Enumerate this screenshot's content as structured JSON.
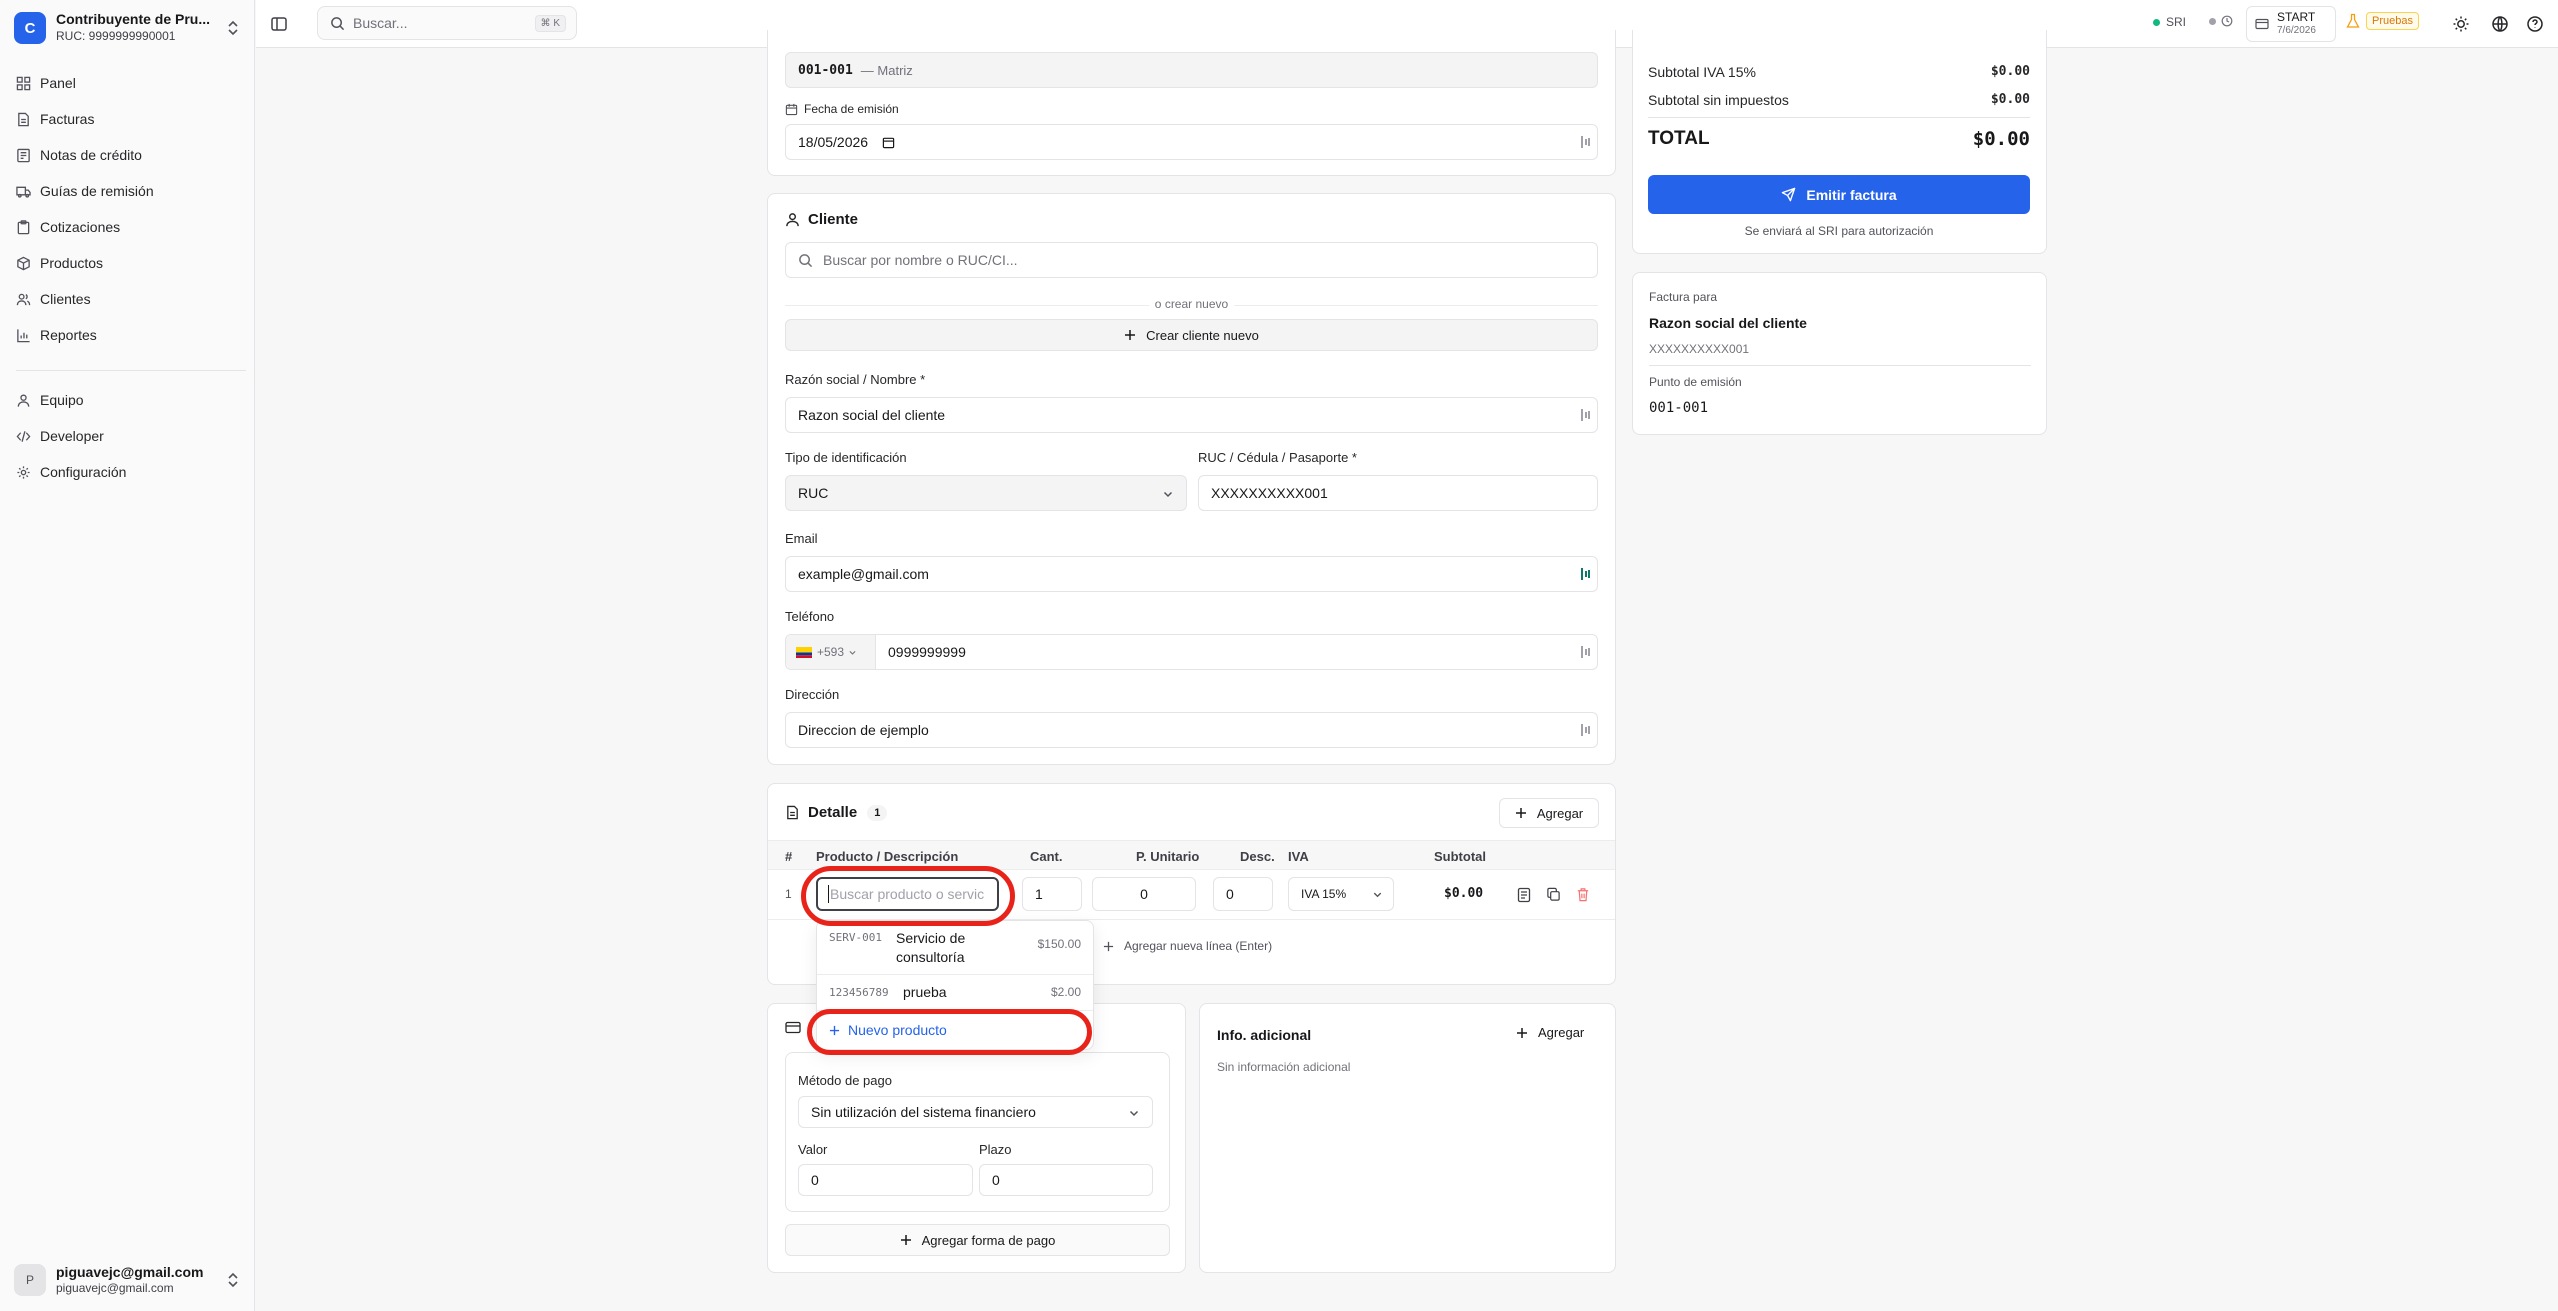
{
  "org": {
    "initial": "C",
    "name": "Contribuyente de Pru...",
    "ruc": "RUC: 9999999990001"
  },
  "nav": {
    "main": [
      {
        "label": "Panel",
        "icon": "grid-icon"
      },
      {
        "label": "Facturas",
        "icon": "file-icon"
      },
      {
        "label": "Notas de crédito",
        "icon": "note-icon"
      },
      {
        "label": "Guías de remisión",
        "icon": "truck-icon"
      },
      {
        "label": "Cotizaciones",
        "icon": "clipboard-icon"
      },
      {
        "label": "Productos",
        "icon": "box-icon"
      },
      {
        "label": "Clientes",
        "icon": "users-icon"
      },
      {
        "label": "Reportes",
        "icon": "chart-icon"
      }
    ],
    "secondary": [
      {
        "label": "Equipo",
        "icon": "team-icon"
      },
      {
        "label": "Developer",
        "icon": "code-icon"
      },
      {
        "label": "Configuración",
        "icon": "gear-icon"
      }
    ]
  },
  "user": {
    "initial": "P",
    "name": "piguavejc@gmail.com",
    "email": "piguavejc@gmail.com"
  },
  "topbar": {
    "search_placeholder": "Buscar...",
    "search_shortcut": "⌘ K",
    "sri_label": "SRI",
    "plan_label": "START",
    "plan_date": "7/6/2026",
    "env_badge": "Pruebas"
  },
  "emission": {
    "point_code": "001-001",
    "point_name": "— Matriz",
    "date_label": "Fecha de emisión",
    "date_value": "18/05/2026"
  },
  "client": {
    "title": "Cliente",
    "search_placeholder": "Buscar por nombre o RUC/CI...",
    "or_new": "o crear nuevo",
    "create_button": "Crear cliente nuevo",
    "name_label": "Razón social / Nombre *",
    "name_value": "Razon social del cliente",
    "idtype_label": "Tipo de identificación",
    "idtype_value": "RUC",
    "ruc_label": "RUC / Cédula / Pasaporte *",
    "ruc_value": "XXXXXXXXXX001",
    "email_label": "Email",
    "email_value": "example@gmail.com",
    "phone_label": "Teléfono",
    "phone_prefix": "+593",
    "phone_value": "0999999999",
    "address_label": "Dirección",
    "address_value": "Direccion de ejemplo"
  },
  "detail": {
    "title": "Detalle",
    "count": "1",
    "add_button": "Agregar",
    "columns": [
      "#",
      "Producto / Descripción",
      "Cant.",
      "P. Unitario",
      "Desc.",
      "IVA",
      "Subtotal"
    ],
    "row": {
      "index": "1",
      "product_placeholder": "Buscar producto o servic",
      "qty": "1",
      "unit_price": "0",
      "discount": "0",
      "iva": "IVA 15%",
      "subtotal": "$0.00"
    },
    "add_line": "Agregar nueva línea (Enter)"
  },
  "dropdown": {
    "items": [
      {
        "code": "SERV-001",
        "name": "Servicio de consultoría",
        "price": "$150.00"
      },
      {
        "code": "123456789",
        "name": "prueba",
        "price": "$2.00"
      }
    ],
    "new_product": "Nuevo producto"
  },
  "payment": {
    "method_label": "Método de pago",
    "method_value": "Sin utilización del sistema financiero",
    "value_label": "Valor",
    "value_value": "0",
    "term_label": "Plazo",
    "term_value": "0",
    "add_payment": "Agregar forma de pago"
  },
  "info": {
    "title": "Info. adicional",
    "add_button": "Agregar",
    "empty": "Sin información adicional"
  },
  "summary": {
    "subtotal_iva_label": "Subtotal IVA 15%",
    "subtotal_iva_value": "$0.00",
    "subtotal_no_tax_label": "Subtotal sin impuestos",
    "subtotal_no_tax_value": "$0.00",
    "total_label": "TOTAL",
    "total_value": "$0.00",
    "emit_button": "Emitir factura",
    "emit_note": "Se enviará al SRI para autorización"
  },
  "invoice_for": {
    "label": "Factura para",
    "client_name": "Razon social del cliente",
    "client_ruc": "XXXXXXXXXX001",
    "point_label": "Punto de emisión",
    "point_value": "001-001"
  },
  "colors": {
    "primary": "#2563eb",
    "highlight": "#e8231a",
    "status_ok": "#10b981"
  }
}
